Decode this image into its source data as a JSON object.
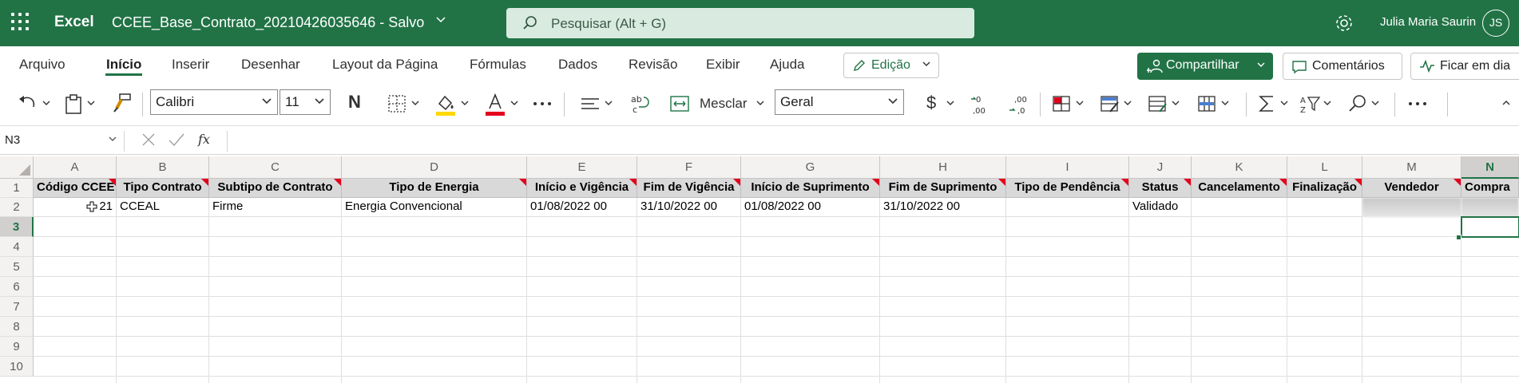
{
  "titlebar": {
    "app_name": "Excel",
    "doc_title": "CCEE_Base_Contrato_20210426035646  -  Salvo",
    "search_placeholder": "Pesquisar (Alt + G)",
    "user_name": "Julia Maria Saurin",
    "user_initials": "JS"
  },
  "ribbon": {
    "tabs": [
      {
        "label": "Arquivo",
        "active": false
      },
      {
        "label": "Início",
        "active": true
      },
      {
        "label": "Inserir",
        "active": false
      },
      {
        "label": "Desenhar",
        "active": false
      },
      {
        "label": "Layout da Página",
        "active": false
      },
      {
        "label": "Fórmulas",
        "active": false
      },
      {
        "label": "Dados",
        "active": false
      },
      {
        "label": "Revisão",
        "active": false
      },
      {
        "label": "Exibir",
        "active": false
      },
      {
        "label": "Ajuda",
        "active": false
      }
    ],
    "edit_mode_label": "Edição",
    "share_label": "Compartilhar",
    "comments_label": "Comentários",
    "stay_label": "Ficar em dia"
  },
  "toolbar": {
    "font_name": "Calibri",
    "font_size": "11",
    "bold_label": "N",
    "merge_label": "Mesclar",
    "number_format": "Geral",
    "currency_symbol": "$",
    "fill_color": "#ffd800",
    "font_color": "#e3001b"
  },
  "formula_bar": {
    "name_box": "N3",
    "fx_label": "fx",
    "formula": ""
  },
  "sheet": {
    "accent": "#217346",
    "column_letters": [
      "A",
      "B",
      "C",
      "D",
      "E",
      "F",
      "G",
      "H",
      "I",
      "J",
      "K",
      "L",
      "M",
      "N"
    ],
    "row_numbers": [
      "1",
      "2",
      "3",
      "4",
      "5",
      "6",
      "7",
      "8",
      "9",
      "10"
    ],
    "headers": [
      "Código CCEE",
      "Tipo Contrato",
      "Subtipo de Contrato",
      "Tipo de Energia",
      "Início e Vigência",
      "Fim de Vigência",
      "Início de Suprimento",
      "Fim de Suprimento",
      "Tipo de Pendência",
      "Status",
      "Cancelamento",
      "Finalização",
      "Vendedor",
      "Compra"
    ],
    "row2": [
      "21",
      "CCEAL",
      "Firme",
      "Energia Convencional",
      "01/08/2022 00",
      "31/10/2022 00",
      "01/08/2022 00",
      "31/10/2022 00",
      "",
      "Validado",
      "",
      "",
      "",
      ""
    ],
    "selected_column": "N",
    "selected_row": "3"
  }
}
